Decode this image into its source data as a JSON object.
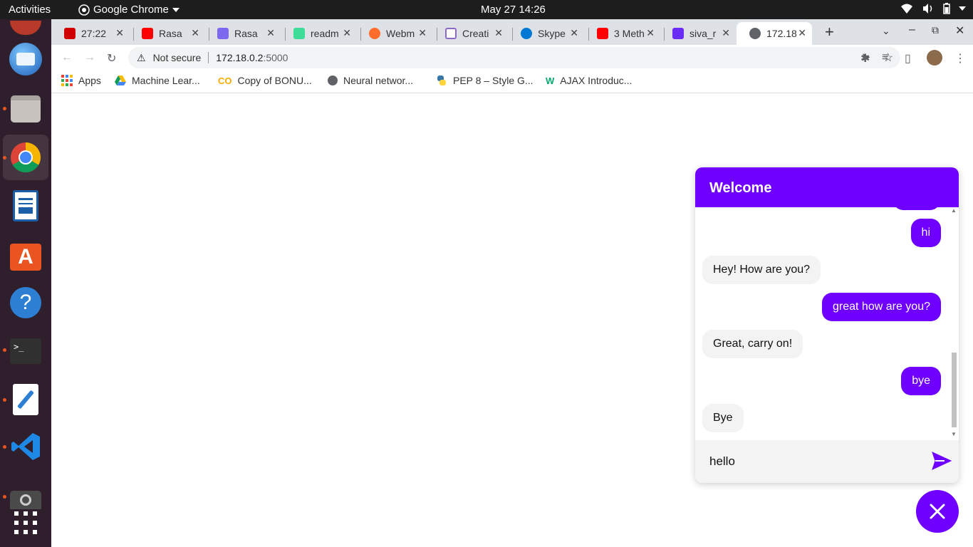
{
  "topbar": {
    "activities": "Activities",
    "app_name": "Google Chrome",
    "clock": "May 27  14:26"
  },
  "dock": {
    "items": [
      "thunderbird-icon",
      "files-icon",
      "chrome-icon",
      "writer-icon",
      "software-icon",
      "help-icon",
      "terminal-icon",
      "text-editor-icon",
      "vscode-icon",
      "camera-icon",
      "apps-grid-icon"
    ]
  },
  "tabs": [
    {
      "label": "27:22",
      "color": "#d00000"
    },
    {
      "label": "Rasa C",
      "color": "#ff0000"
    },
    {
      "label": "Rasa c",
      "color": "#7b68ee"
    },
    {
      "label": "readm",
      "color": "#3ddc97"
    },
    {
      "label": "Webm",
      "color": "#ff6c2c"
    },
    {
      "label": "Creati",
      "color": "#8e6ac8"
    },
    {
      "label": "Skype",
      "color": "#0078d4"
    },
    {
      "label": "3 Meth",
      "color": "#ff0000"
    },
    {
      "label": "siva_r",
      "color": "#6b2cf5"
    },
    {
      "label": "172.18",
      "color": "#5f6368"
    }
  ],
  "address": {
    "security": "Not secure",
    "url": "172.18.0.2",
    "port": ":5000"
  },
  "bookmarks": [
    "Apps",
    "Machine Lear...",
    "Copy of BONU...",
    "Neural networ...",
    "PEP 8 – Style G...",
    "AJAX Introduc..."
  ],
  "chat": {
    "title": "Welcome",
    "messages": [
      {
        "sender": "user",
        "text": "hi"
      },
      {
        "sender": "bot",
        "text": "Hey! How are you?"
      },
      {
        "sender": "user",
        "text": "great how are you?"
      },
      {
        "sender": "bot",
        "text": "Great, carry on!"
      },
      {
        "sender": "user",
        "text": "bye"
      },
      {
        "sender": "bot",
        "text": "Bye"
      }
    ],
    "input_value": "hello"
  },
  "colors": {
    "accent": "#6f00ff",
    "dock_bg": "#2f1f2c",
    "topbar_bg": "#1d1d1d"
  }
}
